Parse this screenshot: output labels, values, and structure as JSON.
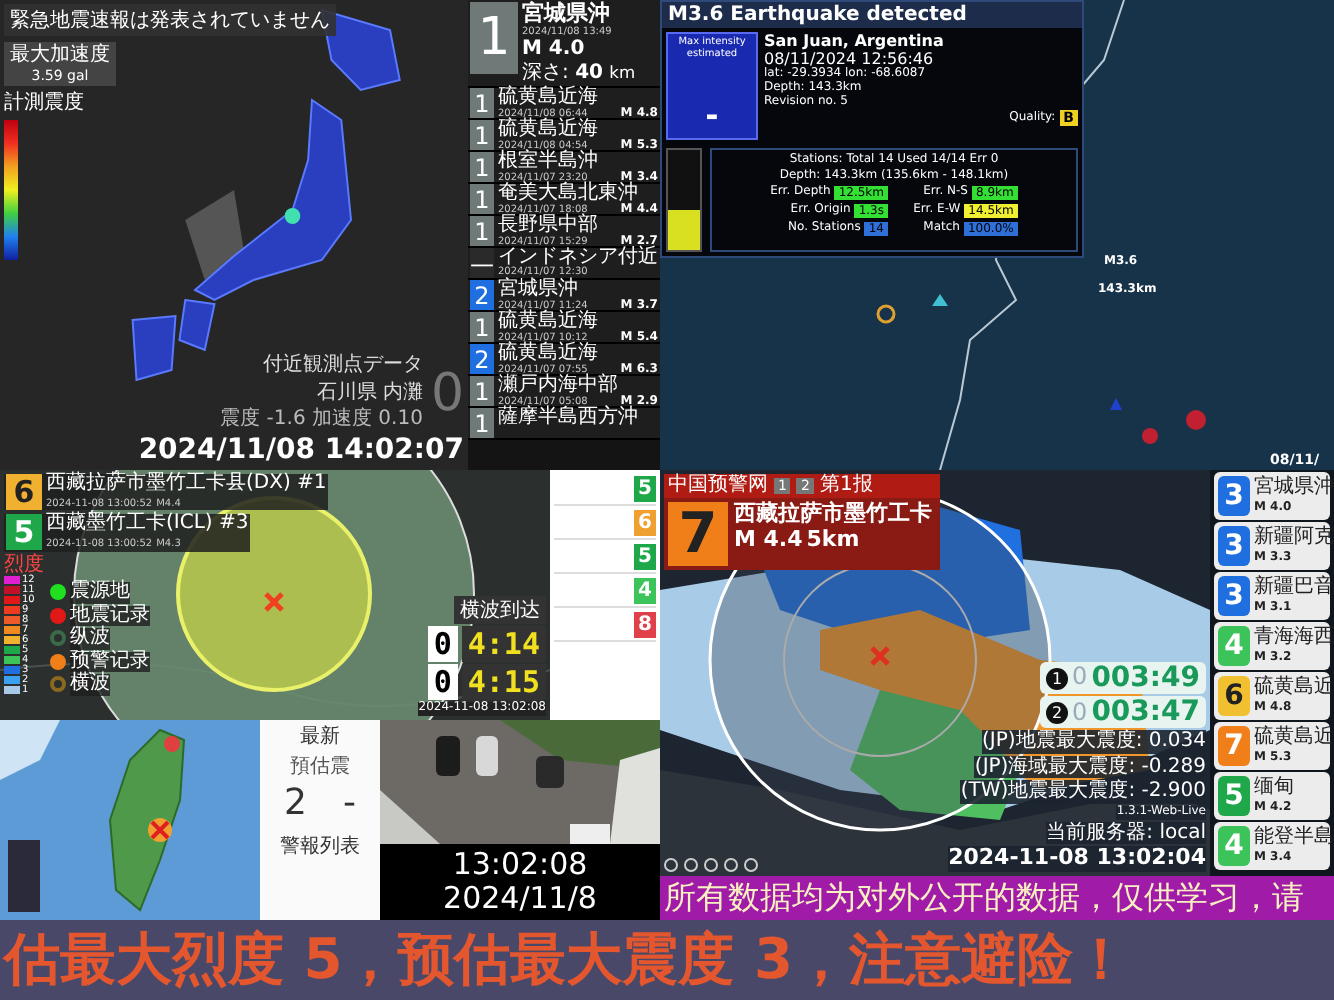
{
  "japan_monitor": {
    "alert": "緊急地震速報は発表されていません",
    "max_acceleration_label": "最大加速度",
    "max_acceleration": "3.59 gal",
    "scale_label": "計測震度",
    "nearby_title": "付近観測点データ",
    "nearby_station": "石川県 内灘",
    "nearby_values": "震度 -1.6 加速度 0.10",
    "nearby_intensity": "0",
    "clock": "2024/11/08 14:02:07"
  },
  "japan_quakes": {
    "latest": {
      "intensity": "1",
      "color": "#6f7a78",
      "place": "宮城県沖",
      "time": "2024/11/08 13:49",
      "magnitude": "M 4.0",
      "depth_label": "深さ:",
      "depth": "40",
      "depth_unit": "km"
    },
    "items": [
      {
        "intensity": "1",
        "color": "#6f7a78",
        "place": "硫黄島近海",
        "time": "2024/11/08 06:44",
        "magnitude": "M 4.8"
      },
      {
        "intensity": "1",
        "color": "#6f7a78",
        "place": "硫黄島近海",
        "time": "2024/11/08 04:54",
        "magnitude": "M 5.3"
      },
      {
        "intensity": "1",
        "color": "#6f7a78",
        "place": "根室半島沖",
        "time": "2024/11/07 23:20",
        "magnitude": "M 3.4"
      },
      {
        "intensity": "1",
        "color": "#6f7a78",
        "place": "奄美大島北東沖",
        "time": "2024/11/07 18:08",
        "magnitude": "M 4.4"
      },
      {
        "intensity": "1",
        "color": "#6f7a78",
        "place": "長野県中部",
        "time": "2024/11/07 15:29",
        "magnitude": "M 2.7"
      },
      {
        "intensity": "—",
        "color": "#2a2a2a",
        "place": "インドネシア付近",
        "time": "2024/11/07 12:30"
      },
      {
        "intensity": "2",
        "color": "#1f6fe0",
        "place": "宮城県沖",
        "time": "2024/11/07 11:24",
        "magnitude": "M 3.7"
      },
      {
        "intensity": "1",
        "color": "#6f7a78",
        "place": "硫黄島近海",
        "time": "2024/11/07 10:12",
        "magnitude": "M 5.4"
      },
      {
        "intensity": "2",
        "color": "#1f6fe0",
        "place": "硫黄島近海",
        "time": "2024/11/07 07:55",
        "magnitude": "M 6.3"
      },
      {
        "intensity": "1",
        "color": "#6f7a78",
        "place": "瀬戸内海中部",
        "time": "2024/11/07 05:08",
        "magnitude": "M 2.9"
      },
      {
        "intensity": "1",
        "color": "#6f7a78",
        "place": "薩摩半島西方沖"
      }
    ]
  },
  "eew_panel": {
    "title": "M3.6 Earthquake detected",
    "max_intensity_label": "Max intensity estimated",
    "max_intensity": "-",
    "region": "San Juan, Argentina",
    "time": "08/11/2024 12:56:46",
    "coords": "lat: -29.3934 lon: -68.6087",
    "depth": "Depth: 143.3km",
    "revision": "Revision no. 5",
    "quality_label": "Quality:",
    "quality": "B",
    "magnitude_meter": {
      "level": 0.4
    },
    "stations": "Stations: Total 14 Used 14/14 Err 0",
    "depth_range": "Depth: 143.3km (135.6km - 148.1km)",
    "errors": [
      {
        "label": "Err. Depth",
        "value": "12.5km",
        "color": "#35e035"
      },
      {
        "label": "Err. N-S",
        "value": "8.9km",
        "color": "#35e035"
      },
      {
        "label": "Err. Origin",
        "value": "1.3s",
        "color": "#35e035"
      },
      {
        "label": "Err. E-W",
        "value": "14.5km",
        "color": "#f0f030"
      },
      {
        "label": "No. Stations",
        "value": "14",
        "color": "#2f6fd8"
      },
      {
        "label": "Match",
        "value": "100.0%",
        "color": "#2f6fd8"
      }
    ]
  },
  "station_map": {
    "magnitude": "M3.6",
    "depth": "143.3km",
    "date": "08/11/"
  },
  "china_left": {
    "cards": [
      {
        "intensity": "6",
        "color": "#f0b030",
        "place": "西藏拉萨市墨竹工卡县(DX) #1",
        "time": "2024-11-08 13:00:52",
        "magnitude": "M4.4"
      },
      {
        "intensity": "5",
        "color": "#1fa84a",
        "place": "西藏墨竹工卡(ICL) #3",
        "time": "2024-11-08 13:00:52",
        "magnitude": "M4.3"
      }
    ],
    "scale_title": "烈度",
    "scale": [
      {
        "label": "12",
        "color": "#e020d0"
      },
      {
        "label": "11",
        "color": "#c0102a"
      },
      {
        "label": "10",
        "color": "#e01818"
      },
      {
        "label": "9",
        "color": "#f03a20"
      },
      {
        "label": "8",
        "color": "#f05a28"
      },
      {
        "label": "7",
        "color": "#f08a20"
      },
      {
        "label": "6",
        "color": "#f0b030"
      },
      {
        "label": "5",
        "color": "#1fa84a"
      },
      {
        "label": "4",
        "color": "#3cc35a"
      },
      {
        "label": "3",
        "color": "#1f6fe0"
      },
      {
        "label": "2",
        "color": "#3aa0f0"
      },
      {
        "label": "1",
        "color": "#a8c8e8"
      }
    ],
    "legend": [
      {
        "label": "震源地",
        "kind": "dot",
        "color": "#20e020"
      },
      {
        "label": "地震记录",
        "kind": "dot",
        "color": "#e01818"
      },
      {
        "label": "纵波",
        "kind": "ring",
        "color": "#3a6a4a"
      },
      {
        "label": "预警记录",
        "kind": "dot",
        "color": "#f07f1a"
      },
      {
        "label": "横波",
        "kind": "ring",
        "color": "#8a6a20"
      }
    ],
    "countdown_title": "横波到达",
    "countdowns": [
      {
        "count": "0",
        "time": "4:14"
      },
      {
        "count": "0",
        "time": "4:15"
      }
    ],
    "clock": "2024-11-08 13:02:08"
  },
  "side_list": [
    {
      "intensity": "5",
      "color": "#1fa84a"
    },
    {
      "intensity": "6",
      "color": "#f0a030"
    },
    {
      "intensity": "5",
      "color": "#1fa84a"
    },
    {
      "intensity": "4",
      "color": "#3cc35a"
    },
    {
      "intensity": "8",
      "color": "#e0404a"
    }
  ],
  "china_right": {
    "source": "中国预警网",
    "report_tabs": [
      "1",
      "2"
    ],
    "report_no": "第1报",
    "intensity": "7",
    "color": "#f07f1a",
    "place": "西藏拉萨市墨竹工卡",
    "magnitude": "M 4.4",
    "depth": "5km",
    "countdowns": [
      {
        "index": "1",
        "count": "0",
        "time": "003:49"
      },
      {
        "index": "2",
        "count": "0",
        "time": "003:47"
      }
    ],
    "readings": [
      "(JP)地震最大震度: 0.034",
      "(JP)海域最大震度: -0.289",
      "(TW)地震最大震度: -2.900"
    ],
    "version": "1.3.1-Web-Live",
    "server": "当前服务器: local",
    "clock": "2024-11-08 13:02:04"
  },
  "recent_cards": [
    {
      "intensity": "3",
      "color": "#1f6fe0",
      "place": "宮城県沖",
      "magnitude": "M 4.0"
    },
    {
      "intensity": "3",
      "color": "#1f6fe0",
      "place": "新疆阿克",
      "magnitude": "M 3.3"
    },
    {
      "intensity": "3",
      "color": "#1f6fe0",
      "place": "新疆巴音",
      "magnitude": "M 3.1"
    },
    {
      "intensity": "4",
      "color": "#3cc35a",
      "place": "青海海西",
      "magnitude": "M 3.2"
    },
    {
      "intensity": "6",
      "color": "#f0c030",
      "place": "硫黄島近",
      "magnitude": "M 4.8"
    },
    {
      "intensity": "7",
      "color": "#f07f1a",
      "place": "硫黄島近",
      "magnitude": "M 5.3"
    },
    {
      "intensity": "5",
      "color": "#1fa84a",
      "place": "缅甸",
      "magnitude": "M 4.2"
    },
    {
      "intensity": "4",
      "color": "#3cc35a",
      "place": "能登半島",
      "magnitude": "M 3.4"
    }
  ],
  "taiwan_panel": {
    "title": "最新",
    "estimate_label": "預估震",
    "estimate": "2",
    "estimate_second": "-",
    "list_title": "警報列表"
  },
  "time_box": {
    "time": "13:02:08",
    "date": "2024/11/8"
  },
  "marquee": "所有数据均为对外公开的数据，仅供学习，请",
  "warning": "估最大烈度 5，预估最大震度 3，注意避险！"
}
